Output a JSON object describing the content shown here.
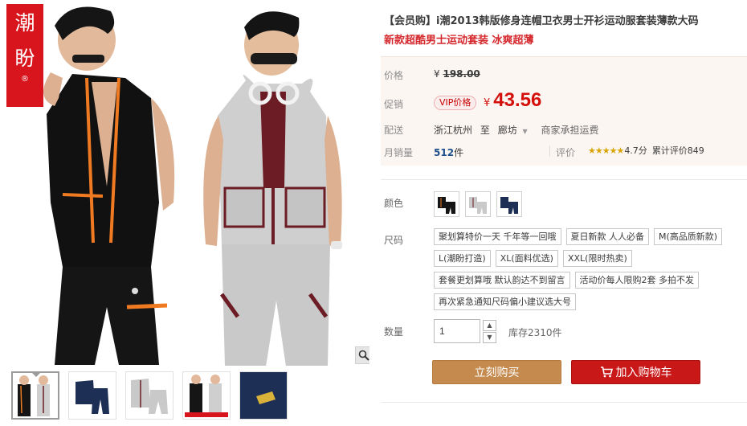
{
  "gallery": {
    "brand_chars": [
      "潮",
      "盼"
    ],
    "brand_mark": "®",
    "accent": "#d8141c",
    "thumbnails": [
      "thumb-1",
      "thumb-2",
      "thumb-3",
      "thumb-4",
      "thumb-5"
    ],
    "active_thumbnail": 0,
    "zoom_icon": "magnifier-icon"
  },
  "product": {
    "title": "【会员购】i潮2013韩版修身连帽卫衣男士开衫运动服套装薄款大码",
    "subtitle": "新款超酷男士运动套装 冰爽超薄"
  },
  "pricing": {
    "price_label": "价格",
    "original_currency": "¥",
    "original_price": "198.00",
    "promo_label": "促销",
    "vip_tag": "VIP价格",
    "promo_currency": "¥",
    "promo_price": "43.56",
    "price_color": "#d3100b"
  },
  "shipping": {
    "label": "配送",
    "from": "浙江杭州",
    "to_word": "至",
    "to": "廊坊",
    "fee_note": "商家承担运费"
  },
  "sales": {
    "label": "月销量",
    "count": "512",
    "unit": "件",
    "rating_label": "评价",
    "stars": "★★★★★",
    "score": "4.7分",
    "total_reviews": "累计评价849"
  },
  "color": {
    "label": "颜色",
    "options": [
      "black-orange",
      "grey-red",
      "navy"
    ]
  },
  "size": {
    "label": "尺码",
    "options": [
      [
        "聚划算特价一天 千年等一回哦",
        "夏日新款 人人必备",
        "M(高品质新款)"
      ],
      [
        "L(潮盼打造)",
        "XL(面料优选)",
        "XXL(限时热卖)"
      ],
      [
        "套餐更划算哦 默认韵达不到留言",
        "活动价每人限购2套 多拍不发"
      ],
      [
        "再次紧急通知尺码偏小建议选大号"
      ]
    ]
  },
  "quantity": {
    "label": "数量",
    "value": "1",
    "stock": "库存2310件"
  },
  "actions": {
    "buy_now": "立刻购买",
    "add_to_cart": "加入购物车",
    "buy_color": "#c58a4e",
    "cart_color": "#c81818"
  }
}
